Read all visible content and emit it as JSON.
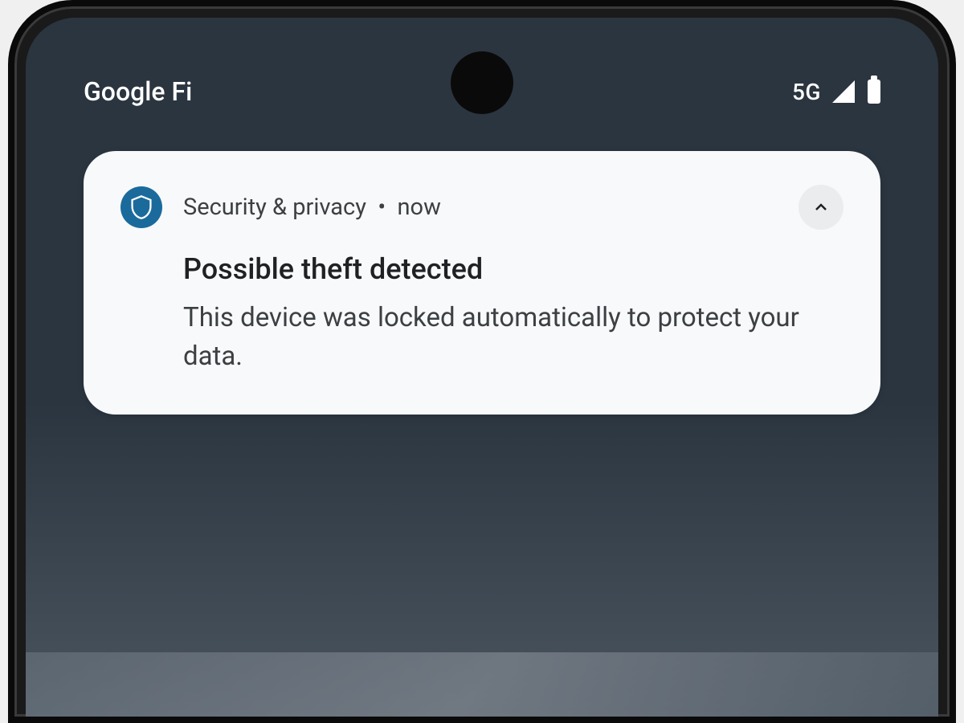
{
  "status_bar": {
    "carrier": "Google Fi",
    "network": "5G"
  },
  "notification": {
    "app_name": "Security & privacy",
    "separator": "•",
    "time": "now",
    "title": "Possible theft detected",
    "body": "This device was locked automatically to protect your data."
  }
}
